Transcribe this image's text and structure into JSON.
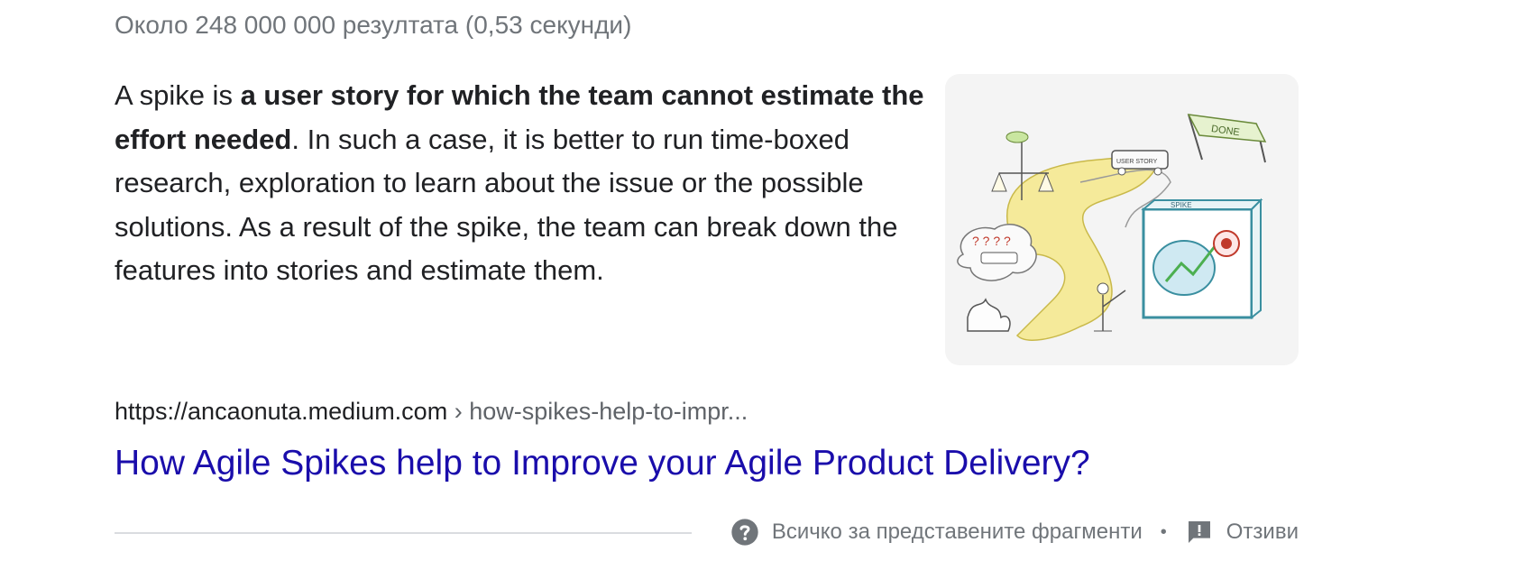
{
  "result_stats": "Около 248 000 000 резултата (0,53 секунди)",
  "snippet": {
    "text_prefix": "A spike is ",
    "text_bold": "a user story for which the team cannot estimate the effort needed",
    "text_suffix": ". In such a case, it is better to run time-boxed research, exploration to learn about the issue or the possible solutions. As a result of the spike, the team can break down the features into stories and estimate them."
  },
  "thumbnail": {
    "label_done": "DONE",
    "label_spike": "SPIKE",
    "label_user_story": "USER STORY",
    "label_questions": "? ? ? ?"
  },
  "source": {
    "domain": "https://ancaonuta.medium.com",
    "breadcrumb": " › how-spikes-help-to-impr..."
  },
  "result_title": "How Agile Spikes help to Improve your Agile Product Delivery?",
  "footer": {
    "about_label": "Всичко за представените фрагменти",
    "separator": "•",
    "feedback_label": "Отзиви"
  },
  "colors": {
    "link": "#1a0dab",
    "muted": "#70757a",
    "text": "#202124",
    "path_yellow": "#f5ea9a",
    "box_teal": "#3a8fa0"
  }
}
